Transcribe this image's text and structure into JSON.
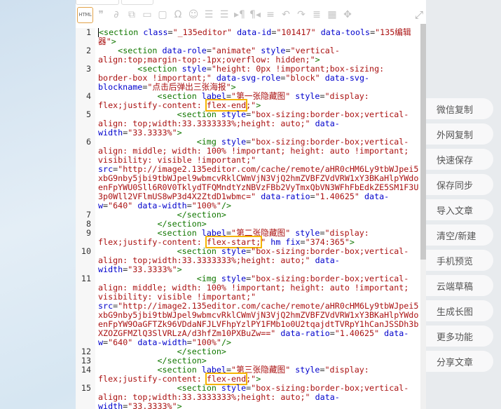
{
  "toolbar": {
    "html_label": "HTML",
    "icons": [
      "quote-icon",
      "link-icon",
      "unlink-icon",
      "table-icon",
      "image-icon",
      "special-char-icon",
      "emoji-icon",
      "ordered-list-icon",
      "unordered-list-icon",
      "ltr-icon",
      "rtl-icon",
      "line-height-icon",
      "undo-icon",
      "redo-icon",
      "justify-icon",
      "grid-icon",
      "move-icon"
    ],
    "glyphs": [
      "❞",
      "∂",
      "⧉",
      "▭",
      "▢",
      "Ω",
      "☺",
      "☰",
      "☰",
      "▸¶",
      "¶◂",
      "≡",
      "↶",
      "↷",
      "≣",
      "▦",
      "✥"
    ],
    "fullscreen_glyph": "⤢"
  },
  "code_lines": [
    {
      "n": "1",
      "tokens": [
        [
          "t",
          "<section"
        ],
        [
          "a",
          " class"
        ],
        [
          "p",
          "="
        ],
        [
          "s",
          "\"_135editor\""
        ],
        [
          "a",
          " data-id"
        ],
        [
          "p",
          "="
        ],
        [
          "s",
          "\"101417\""
        ],
        [
          "a",
          " data-tools"
        ],
        [
          "p",
          "="
        ],
        [
          "s",
          "\"135编辑器\""
        ],
        [
          "t",
          ">"
        ]
      ]
    },
    {
      "n": "2",
      "tokens": [
        [
          "p",
          "    "
        ],
        [
          "t",
          "<section"
        ],
        [
          "a",
          " data-role"
        ],
        [
          "p",
          "="
        ],
        [
          "s",
          "\"animate\""
        ],
        [
          "a",
          " style"
        ],
        [
          "p",
          "="
        ],
        [
          "s",
          "\"vertical-align:top;margin-top:-1px;overflow: hidden;\""
        ],
        [
          "t",
          ">"
        ]
      ]
    },
    {
      "n": "3",
      "tokens": [
        [
          "p",
          "        "
        ],
        [
          "t",
          "<section"
        ],
        [
          "a",
          " style"
        ],
        [
          "p",
          "="
        ],
        [
          "s",
          "\"height: 0px !important;box-sizing: border-box !important;\""
        ],
        [
          "a",
          " data-svg-role"
        ],
        [
          "p",
          "="
        ],
        [
          "s",
          "\"block\""
        ],
        [
          "a",
          " data-svg-blockname"
        ],
        [
          "p",
          "="
        ],
        [
          "s",
          "\"点击后弹出三张海报\""
        ],
        [
          "t",
          ">"
        ]
      ]
    },
    {
      "n": "4",
      "tokens": [
        [
          "p",
          "            "
        ],
        [
          "t",
          "<section"
        ],
        [
          "a",
          " label"
        ],
        [
          "p",
          "="
        ],
        [
          "s",
          "\"第一张隐藏图\""
        ],
        [
          "a",
          " style"
        ],
        [
          "p",
          "="
        ],
        [
          "s",
          "\"display: flex;justify-content: "
        ],
        [
          "h",
          "flex-end"
        ],
        [
          "s",
          ";\""
        ],
        [
          "t",
          ">"
        ]
      ]
    },
    {
      "n": "5",
      "tokens": [
        [
          "p",
          "                "
        ],
        [
          "t",
          "<section"
        ],
        [
          "a",
          " style"
        ],
        [
          "p",
          "="
        ],
        [
          "s",
          "\"box-sizing:border-box;vertical-align: top;width:33.3333333%;height: auto;\""
        ],
        [
          "a",
          " data-width"
        ],
        [
          "p",
          "="
        ],
        [
          "s",
          "\"33.3333%\""
        ],
        [
          "t",
          ">"
        ]
      ]
    },
    {
      "n": "6",
      "tokens": [
        [
          "p",
          "                    "
        ],
        [
          "t",
          "<img"
        ],
        [
          "a",
          " style"
        ],
        [
          "p",
          "="
        ],
        [
          "s",
          "\"box-sizing:border-box;vertical-align: middle; width: 100% !important; height: auto !important; visibility: visible !important;\""
        ],
        [
          "a",
          " src"
        ],
        [
          "p",
          "="
        ],
        [
          "s",
          "\"http://image2.135editor.com/cache/remote/aHR0cHM6Ly9tbWJpei5xbG9nby5jbi9tbWJpel9wbmcvRklCWmVjN3VjQ2hmZVBFZVdVRW1xY3BKaHlpYWdoenFpYWU0Sll6R0V0TklydTFQMndtYzNBVzFBb2VyTmxQbVN3WFhFbEdkZE5SM1F3U3p0Wll2VFlmUS8wP3d4X2ZtdD1wbmc=\""
        ],
        [
          "a",
          " data-ratio"
        ],
        [
          "p",
          "="
        ],
        [
          "s",
          "\"1.40625\""
        ],
        [
          "a",
          " data-w"
        ],
        [
          "p",
          "="
        ],
        [
          "s",
          "\"640\""
        ],
        [
          "a",
          " data-width"
        ],
        [
          "p",
          "="
        ],
        [
          "s",
          "\"100%\""
        ],
        [
          "t",
          "/>"
        ]
      ]
    },
    {
      "n": "7",
      "tokens": [
        [
          "p",
          "                "
        ],
        [
          "t",
          "</section>"
        ]
      ]
    },
    {
      "n": "8",
      "tokens": [
        [
          "p",
          "            "
        ],
        [
          "t",
          "</section>"
        ]
      ]
    },
    {
      "n": "9",
      "tokens": [
        [
          "p",
          "            "
        ],
        [
          "t",
          "<section"
        ],
        [
          "a",
          " label"
        ],
        [
          "p",
          "="
        ],
        [
          "s",
          "\"第二张隐藏图\""
        ],
        [
          "a",
          " style"
        ],
        [
          "p",
          "="
        ],
        [
          "s",
          "\"display: flex;justify-content: "
        ],
        [
          "h",
          "flex-start;"
        ],
        [
          "s",
          "\""
        ],
        [
          "a",
          " hm fix"
        ],
        [
          "p",
          "="
        ],
        [
          "s",
          "\"374:365\""
        ],
        [
          "t",
          ">"
        ]
      ]
    },
    {
      "n": "10",
      "tokens": [
        [
          "p",
          "                "
        ],
        [
          "t",
          "<section"
        ],
        [
          "a",
          " style"
        ],
        [
          "p",
          "="
        ],
        [
          "s",
          "\"box-sizing:border-box;vertical-align: top;width:33.3333333%;height: auto;\""
        ],
        [
          "a",
          " data-width"
        ],
        [
          "p",
          "="
        ],
        [
          "s",
          "\"33.3333%\""
        ],
        [
          "t",
          ">"
        ]
      ]
    },
    {
      "n": "11",
      "tokens": [
        [
          "p",
          "                    "
        ],
        [
          "t",
          "<img"
        ],
        [
          "a",
          " style"
        ],
        [
          "p",
          "="
        ],
        [
          "s",
          "\"box-sizing:border-box;vertical-align: middle; width: 100% !important; height: auto !important; visibility: visible !important;\""
        ],
        [
          "a",
          " src"
        ],
        [
          "p",
          "="
        ],
        [
          "s",
          "\"http://image2.135editor.com/cache/remote/aHR0cHM6Ly9tbWJpei5xbG9nby5jbi9tbWJpel9wbmcvRklCWmVjN3VjQ2hmZVBFZVdVRW1xY3BKaHlpYWdoenFpYW9OaGFTZk96VDdaNFJLVFhpYzlPY1FMb1o0U2tqajdtTVRpY1hCanJSSDh3bXZOZGFMZlQ3SlVRLzA/d3hfZm10PXBuZw==\""
        ],
        [
          "a",
          " data-ratio"
        ],
        [
          "p",
          "="
        ],
        [
          "s",
          "\"1.40625\""
        ],
        [
          "a",
          " data-w"
        ],
        [
          "p",
          "="
        ],
        [
          "s",
          "\"640\""
        ],
        [
          "a",
          " data-width"
        ],
        [
          "p",
          "="
        ],
        [
          "s",
          "\"100%\""
        ],
        [
          "t",
          "/>"
        ]
      ]
    },
    {
      "n": "12",
      "tokens": [
        [
          "p",
          "                "
        ],
        [
          "t",
          "</section>"
        ]
      ]
    },
    {
      "n": "13",
      "tokens": [
        [
          "p",
          "            "
        ],
        [
          "t",
          "</section>"
        ]
      ]
    },
    {
      "n": "14",
      "tokens": [
        [
          "p",
          "            "
        ],
        [
          "t",
          "<section"
        ],
        [
          "a",
          " label"
        ],
        [
          "p",
          "="
        ],
        [
          "s",
          "\"第三张隐藏图\""
        ],
        [
          "a",
          " style"
        ],
        [
          "p",
          "="
        ],
        [
          "s",
          "\"display: flex;justify-content: "
        ],
        [
          "h",
          "flex-end"
        ],
        [
          "s",
          ";\""
        ],
        [
          "t",
          ">"
        ]
      ]
    },
    {
      "n": "15",
      "tokens": [
        [
          "p",
          "                "
        ],
        [
          "t",
          "<section"
        ],
        [
          "a",
          " style"
        ],
        [
          "p",
          "="
        ],
        [
          "s",
          "\"box-sizing:border-box;vertical-align: top;width:33.3333333%;height: auto;\""
        ],
        [
          "a",
          " data-width"
        ],
        [
          "p",
          "="
        ],
        [
          "s",
          "\"33.3333%\""
        ],
        [
          "t",
          ">"
        ]
      ]
    }
  ],
  "side_buttons": [
    "微信复制",
    "外网复制",
    "快速保存",
    "保存同步",
    "导入文章",
    "清空/新建",
    "手机预览",
    "云端草稿",
    "生成长图",
    "更多功能",
    "分享文章"
  ],
  "colors": {
    "tag": "#117700",
    "attr": "#0000cc",
    "string": "#aa1111",
    "highlight": "#f5b400",
    "html_border": "#e3a34a"
  }
}
